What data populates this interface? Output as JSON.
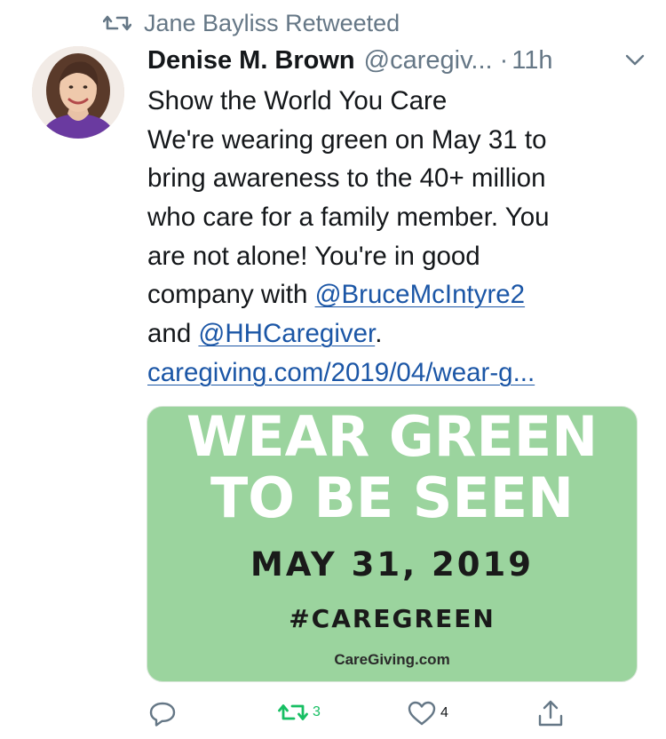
{
  "retweet_context": {
    "text": "Jane Bayliss Retweeted"
  },
  "tweet": {
    "author": {
      "name": "Denise M. Brown",
      "handle": "@caregiv...",
      "avatar_icon": "user-avatar"
    },
    "separator": "·",
    "time": "11h",
    "lines": {
      "l1": "Show the World You Care",
      "l2": "We're wearing green on May 31 to",
      "l3": "bring awareness to the 40+ million",
      "l4": "who care for a family member. You",
      "l5": "are not alone! You're in good",
      "l6_prefix": "company with ",
      "mention1": "@BruceMcIntyre2",
      "l7_prefix": "and ",
      "mention2": "@HHCaregiver",
      "l7_suffix": ".",
      "url": "caregiving.com/2019/04/wear-g..."
    }
  },
  "card": {
    "headline_1": "WEAR GREEN",
    "headline_2": "TO BE SEEN",
    "date": "MAY 31, 2019",
    "hashtag": "#CAREGREEN",
    "site": "CareGiving.com",
    "background_color": "#9bd49e"
  },
  "actions": {
    "reply_count": "",
    "retweet_count": "3",
    "like_count": "4"
  },
  "colors": {
    "link": "#1b56a6",
    "muted": "#657786",
    "retweet_active": "#17bf63"
  }
}
